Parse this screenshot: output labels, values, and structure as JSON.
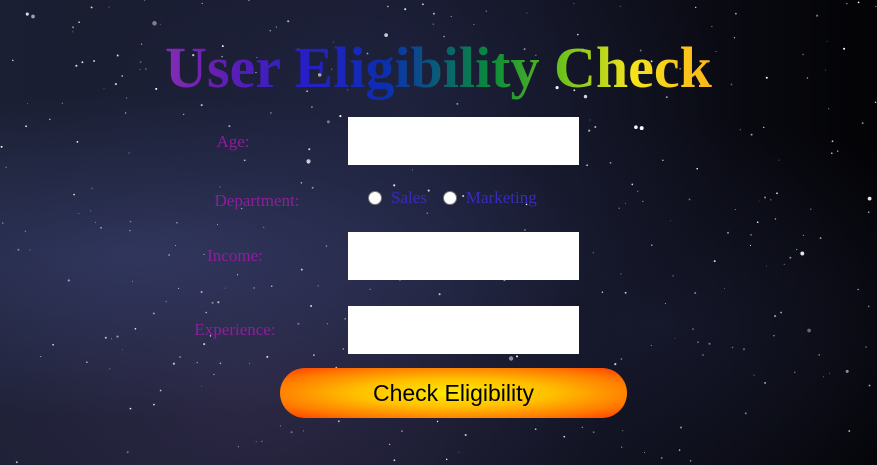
{
  "title": "User Eligibility Check",
  "form": {
    "age_label": "Age:",
    "age_value": "",
    "department_label": "Department:",
    "department_options": [
      "Sales",
      "Marketing"
    ],
    "income_label": "Income:",
    "income_value": "",
    "experience_label": "Experience:",
    "experience_value": "",
    "submit_label": "Check Eligibility"
  },
  "colors": {
    "label": "#8f1d9b",
    "radio_label": "#3a2bb8"
  }
}
